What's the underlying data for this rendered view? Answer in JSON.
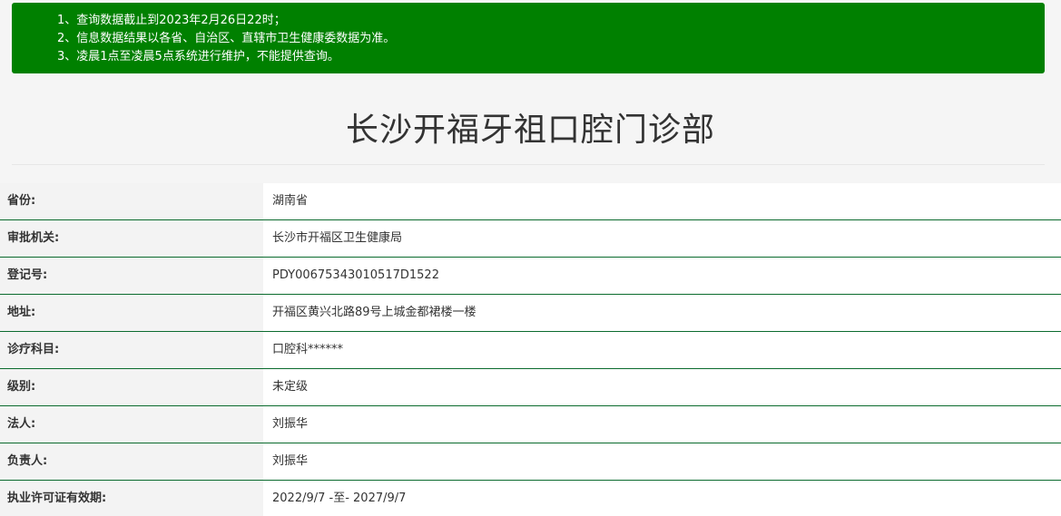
{
  "notice": {
    "lines": [
      "1、查询数据截止到2023年2月26日22时；",
      "2、信息数据结果以各省、自治区、直辖市卫生健康委数据为准。",
      "3、凌晨1点至凌晨5点系统进行维护，不能提供查询。"
    ],
    "background_color": "#008000"
  },
  "title": "长沙开福牙祖口腔门诊部",
  "rows": [
    {
      "label": "省份:",
      "value": "湖南省"
    },
    {
      "label": "审批机关:",
      "value": "长沙市开福区卫生健康局"
    },
    {
      "label": "登记号:",
      "value": "PDY00675343010517D1522"
    },
    {
      "label": "地址:",
      "value": "开福区黄兴北路89号上城金都裙楼一楼"
    },
    {
      "label": "诊疗科目:",
      "value": "口腔科******"
    },
    {
      "label": "级别:",
      "value": "未定级"
    },
    {
      "label": "法人:",
      "value": "刘振华"
    },
    {
      "label": "负责人:",
      "value": "刘振华"
    },
    {
      "label": "执业许可证有效期:",
      "value": "2022/9/7 -至- 2027/9/7"
    }
  ],
  "row_border_color": "#0b6b2e"
}
